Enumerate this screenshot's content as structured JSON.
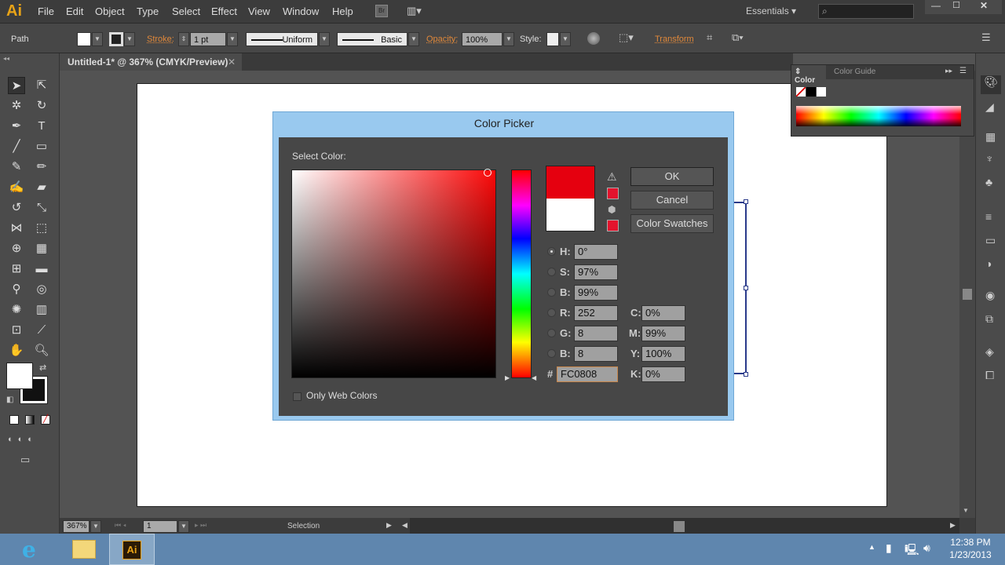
{
  "menubar": {
    "app_logo": "Ai",
    "items": [
      "File",
      "Edit",
      "Object",
      "Type",
      "Select",
      "Effect",
      "View",
      "Window",
      "Help"
    ],
    "bridge": "Br",
    "workspace": "Essentials",
    "search_placeholder": ""
  },
  "control_bar": {
    "selection_type": "Path",
    "stroke_label": "Stroke:",
    "stroke_weight": "1 pt",
    "variable_width": "Uniform",
    "brush": "Basic",
    "opacity_label": "Opacity:",
    "opacity": "100%",
    "style_label": "Style:",
    "transform_label": "Transform"
  },
  "document": {
    "tab_title": "Untitled-1* @ 367% (CMYK/Preview)"
  },
  "color_panel": {
    "tabs": [
      "Color",
      "Color Guide"
    ],
    "active_tab": "Color"
  },
  "status_bar": {
    "zoom": "367%",
    "artboard": "1",
    "tool": "Selection"
  },
  "dialog": {
    "title": "Color Picker",
    "select_color_label": "Select Color:",
    "new_color": "#e5000f",
    "original_color": "#ffffff",
    "buttons": {
      "ok": "OK",
      "cancel": "Cancel",
      "swatches": "Color Swatches"
    },
    "hsb": {
      "H": "0°",
      "S": "97%",
      "B": "99%"
    },
    "rgb": {
      "R": "252",
      "G": "8",
      "B": "8"
    },
    "cmyk": {
      "C": "0%",
      "M": "99%",
      "Y": "100%",
      "K": "0%"
    },
    "hex": "FC0808",
    "hex_label": "#",
    "selected_mode": "H",
    "only_web_colors": "Only Web Colors",
    "only_web_checked": false
  },
  "taskbar": {
    "time": "12:38 PM",
    "date": "1/23/2013",
    "apps": [
      "Internet Explorer",
      "File Explorer",
      "Adobe Illustrator"
    ]
  }
}
